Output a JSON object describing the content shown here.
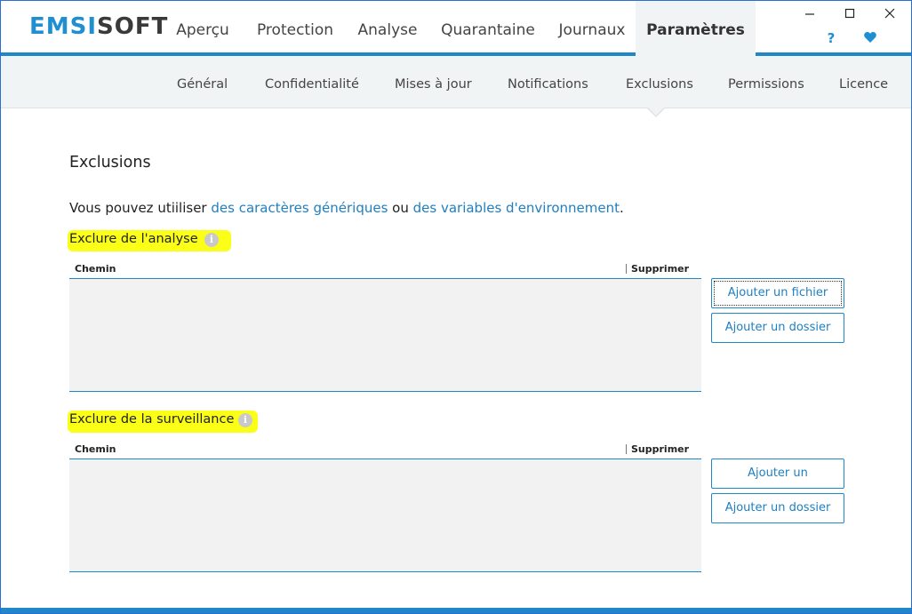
{
  "header": {
    "logo_part1": "EMSI",
    "logo_part2": "SOFT",
    "tabs": [
      {
        "label": "Aperçu"
      },
      {
        "label": "Protection"
      },
      {
        "label": "Analyse"
      },
      {
        "label": "Quarantaine"
      },
      {
        "label": "Journaux"
      },
      {
        "label": "Paramètres",
        "active": true
      }
    ],
    "help_icon": "question-icon",
    "heart_icon": "heart-icon",
    "window_controls": [
      "minimize-icon",
      "maximize-icon",
      "close-icon"
    ]
  },
  "subnav": {
    "tabs": [
      {
        "label": "Général"
      },
      {
        "label": "Confidentialité"
      },
      {
        "label": "Mises à jour"
      },
      {
        "label": "Notifications"
      },
      {
        "label": "Exclusions",
        "active": true
      },
      {
        "label": "Permissions"
      },
      {
        "label": "Licence"
      }
    ]
  },
  "main": {
    "title": "Exclusions",
    "intro_prefix": "Vous pouvez utiiliser ",
    "intro_link1": "des caractères génériques",
    "intro_mid": " ou ",
    "intro_link2": "des variables d'environnement",
    "intro_suffix": ".",
    "scan_section": {
      "title": "Exclure de l'analyse",
      "col_path": "Chemin",
      "col_delete": "Supprimer",
      "add_file_button": "Ajouter un fichier",
      "add_folder_button": "Ajouter un dossier"
    },
    "monitor_section": {
      "title": "Exclure de la surveillance",
      "col_path": "Chemin",
      "col_delete": "Supprimer",
      "add_program_button": "Ajouter un programme",
      "add_folder_button": "Ajouter un dossier"
    }
  },
  "colors": {
    "accent": "#1e88c8",
    "link": "#1f7fc0",
    "highlight": "#fbff17",
    "subnav_bg": "#f1f4f5"
  }
}
